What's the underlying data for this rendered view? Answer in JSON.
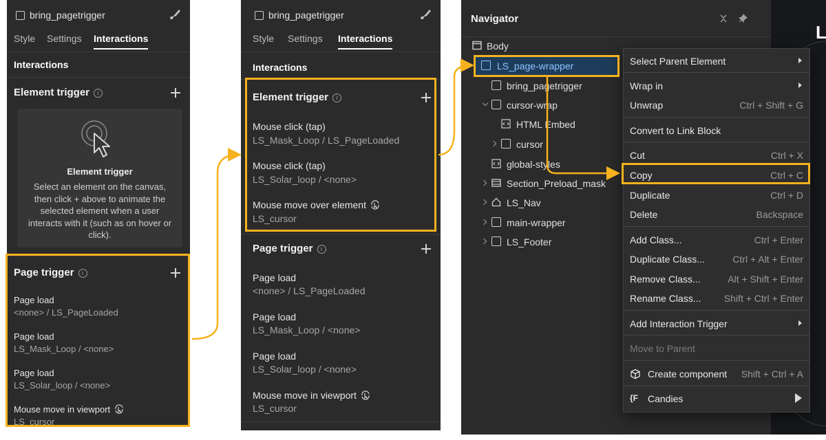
{
  "panel1": {
    "header_title": "bring_pagetrigger",
    "tabs": [
      "Style",
      "Settings",
      "Interactions"
    ],
    "section_label": "Interactions",
    "element_trigger": {
      "title": "Element trigger",
      "empty_title": "Element trigger",
      "empty_desc": "Select an element on the canvas, then click + above to animate the selected element when a user interacts with it (such as on hover or click)."
    },
    "page_trigger": {
      "title": "Page trigger",
      "items": [
        {
          "name": "Page load",
          "sub": "<none> / LS_PageLoaded"
        },
        {
          "name": "Page load",
          "sub": "LS_Mask_Loop / <none>"
        },
        {
          "name": "Page load",
          "sub": "LS_Solar_loop / <none>"
        },
        {
          "name": "Mouse move in viewport",
          "sub": "LS_cursor"
        }
      ]
    }
  },
  "panel2": {
    "header_title": "bring_pagetrigger",
    "tabs": [
      "Style",
      "Settings",
      "Interactions"
    ],
    "section_label": "Interactions",
    "element_trigger": {
      "title": "Element trigger",
      "items": [
        {
          "name": "Mouse click (tap)",
          "sub": "LS_Mask_Loop / LS_PageLoaded"
        },
        {
          "name": "Mouse click (tap)",
          "sub": "LS_Solar_loop / <none>"
        },
        {
          "name": "Mouse move over element",
          "sub": "LS_cursor"
        }
      ]
    },
    "page_trigger": {
      "title": "Page trigger",
      "items": [
        {
          "name": "Page load",
          "sub": "<none> / LS_PageLoaded"
        },
        {
          "name": "Page load",
          "sub": "LS_Mask_Loop / <none>"
        },
        {
          "name": "Page load",
          "sub": "LS_Solar_loop / <none>"
        },
        {
          "name": "Mouse move in viewport",
          "sub": "LS_cursor"
        }
      ]
    }
  },
  "navigator": {
    "title": "Navigator",
    "canvas_letter": "L",
    "tree": [
      {
        "label": "Body",
        "icon": "body-icon"
      },
      {
        "label": "LS_page-wrapper",
        "icon": "box-icon",
        "selected": true
      },
      {
        "label": "bring_pagetrigger",
        "icon": "box-icon"
      },
      {
        "label": "cursor-wrap",
        "icon": "box-icon"
      },
      {
        "label": "HTML Embed",
        "icon": "embed-icon"
      },
      {
        "label": "cursor",
        "icon": "box-icon"
      },
      {
        "label": "global-styles",
        "icon": "embed-icon"
      },
      {
        "label": "Section_Preload_mask",
        "icon": "section-icon"
      },
      {
        "label": "LS_Nav",
        "icon": "home-icon"
      },
      {
        "label": "main-wrapper",
        "icon": "box-icon"
      },
      {
        "label": "LS_Footer",
        "icon": "box-icon"
      }
    ]
  },
  "context_menu": {
    "select_parent": "Select Parent Element",
    "wrap_in": "Wrap in",
    "unwrap": {
      "label": "Unwrap",
      "shortcut": "Ctrl + Shift + G"
    },
    "convert": "Convert to Link Block",
    "cut": {
      "label": "Cut",
      "shortcut": "Ctrl + X"
    },
    "copy": {
      "label": "Copy",
      "shortcut": "Ctrl + C"
    },
    "duplicate": {
      "label": "Duplicate",
      "shortcut": "Ctrl + D"
    },
    "delete": {
      "label": "Delete",
      "shortcut": "Backspace"
    },
    "add_class": {
      "label": "Add Class...",
      "shortcut": "Ctrl + Enter"
    },
    "duplicate_class": {
      "label": "Duplicate Class...",
      "shortcut": "Ctrl + Alt + Enter"
    },
    "remove_class": {
      "label": "Remove Class...",
      "shortcut": "Alt + Shift + Enter"
    },
    "rename_class": {
      "label": "Rename Class...",
      "shortcut": "Shift + Ctrl + Enter"
    },
    "add_trigger": "Add Interaction Trigger",
    "move_to_parent": "Move to Parent",
    "create_component": {
      "label": "Create component",
      "shortcut": "Shift + Ctrl + A"
    },
    "candies": {
      "label": "Candies",
      "icon_text": "{F"
    }
  },
  "colors": {
    "panel_bg": "#2b2b2b",
    "highlight": "#f6b21e",
    "selected_bg": "#1e3d5c",
    "selected_text": "#8fc3ff"
  }
}
